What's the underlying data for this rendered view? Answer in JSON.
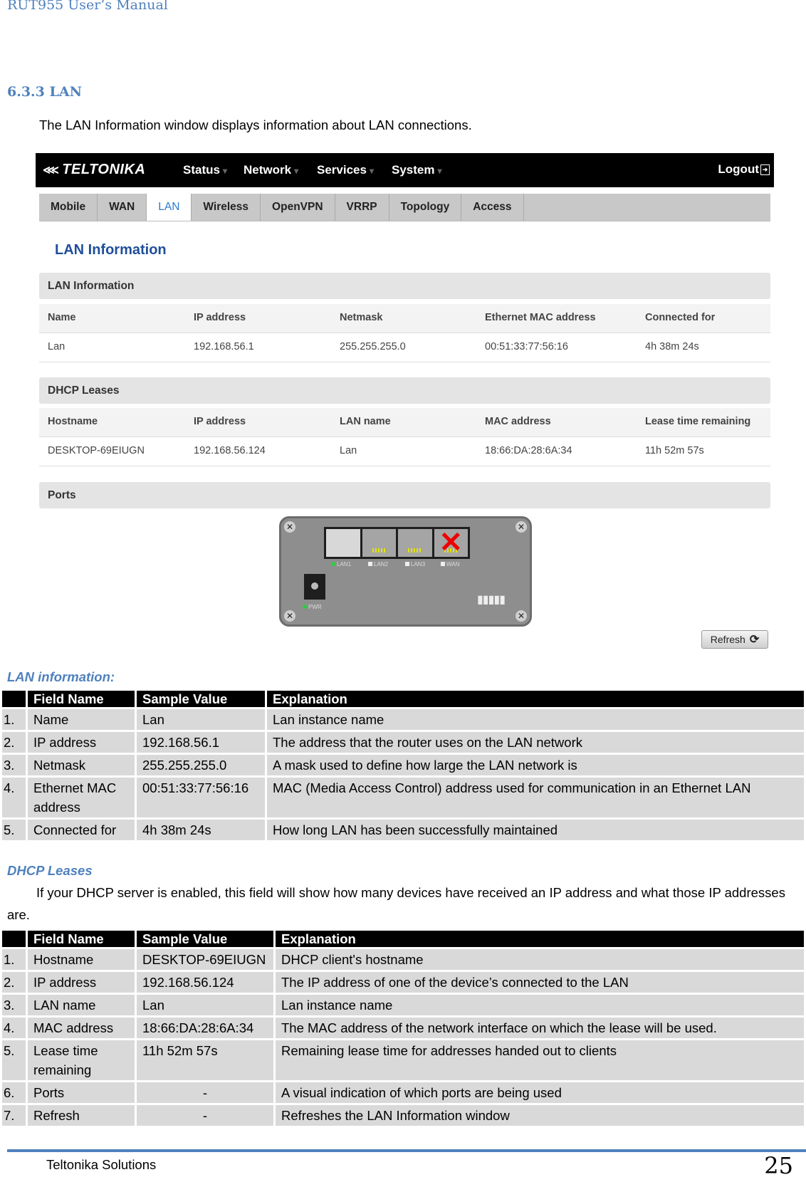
{
  "header": {
    "running_title": "RUT955 User‘s Manual"
  },
  "section": {
    "title": "6.3.3 LAN",
    "intro": "The LAN Information window displays information about LAN connections."
  },
  "screenshot": {
    "brand": "TELTONIKA",
    "nav": [
      "Status",
      "Network",
      "Services",
      "System"
    ],
    "logout": "Logout",
    "tabs": [
      {
        "label": "Mobile",
        "active": false
      },
      {
        "label": "WAN",
        "active": false
      },
      {
        "label": "LAN",
        "active": true
      },
      {
        "label": "Wireless",
        "active": false
      },
      {
        "label": "OpenVPN",
        "active": false
      },
      {
        "label": "VRRP",
        "active": false
      },
      {
        "label": "Topology",
        "active": false
      },
      {
        "label": "Access",
        "active": false
      }
    ],
    "page_title": "LAN Information",
    "lan_section": {
      "title": "LAN Information",
      "headers": [
        "Name",
        "IP address",
        "Netmask",
        "Ethernet MAC address",
        "Connected for"
      ],
      "row": [
        "Lan",
        "192.168.56.1",
        "255.255.255.0",
        "00:51:33:77:56:16",
        "4h 38m 24s"
      ]
    },
    "dhcp_section": {
      "title": "DHCP Leases",
      "headers": [
        "Hostname",
        "IP address",
        "LAN name",
        "MAC address",
        "Lease time remaining"
      ],
      "row": [
        "DESKTOP-69EIUGN",
        "192.168.56.124",
        "Lan",
        "18:66:DA:28:6A:34",
        "11h 52m 57s"
      ]
    },
    "ports_section": {
      "title": "Ports",
      "ports": [
        {
          "label": "LAN1",
          "active": true
        },
        {
          "label": "LAN2",
          "active": false
        },
        {
          "label": "LAN3",
          "active": false
        },
        {
          "label": "WAN",
          "active": false,
          "disabled": true
        }
      ],
      "power_label": "PWR"
    },
    "refresh": "Refresh"
  },
  "lan_table": {
    "heading": "LAN information:",
    "columns": [
      "",
      "Field Name",
      "Sample Value",
      "Explanation"
    ],
    "rows": [
      [
        "1.",
        "Name",
        "Lan",
        "Lan instance name"
      ],
      [
        "2.",
        "IP address",
        "192.168.56.1",
        "The address that the router uses on the LAN network"
      ],
      [
        "3.",
        "Netmask",
        "255.255.255.0",
        "A mask used to define how large the LAN network is"
      ],
      [
        "4.",
        "Ethernet MAC address",
        "00:51:33:77:56:16",
        "MAC (Media Access Control) address used for communication in an Ethernet LAN"
      ],
      [
        "5.",
        "Connected for",
        "4h 38m 24s",
        "How long LAN has been successfully maintained"
      ]
    ]
  },
  "dhcp_table": {
    "heading": "DHCP Leases",
    "description": "If your DHCP server is enabled, this field will show how many devices have received an IP address and what those IP addresses are.",
    "columns": [
      "",
      "Field Name",
      "Sample Value",
      "Explanation"
    ],
    "rows": [
      [
        "1.",
        "Hostname",
        "DESKTOP-69EIUGN",
        "DHCP client's hostname"
      ],
      [
        "2.",
        "IP address",
        "192.168.56.124",
        "The IP address of one of the device’s connected to the LAN"
      ],
      [
        "3.",
        "LAN name",
        "Lan",
        "Lan instance name"
      ],
      [
        "4.",
        "MAC address",
        "18:66:DA:28:6A:34",
        "The MAC address of the network interface on which the lease will be used."
      ],
      [
        "5.",
        "Lease time remaining",
        "11h 52m 57s",
        "Remaining lease time for addresses handed out to clients"
      ],
      [
        "6.",
        "Ports",
        "-",
        "A visual indication of which ports are being used"
      ],
      [
        "7.",
        "Refresh",
        "-",
        "Refreshes the LAN Information window"
      ]
    ]
  },
  "footer": {
    "company": "Teltonika Solutions",
    "page_number": "25"
  }
}
